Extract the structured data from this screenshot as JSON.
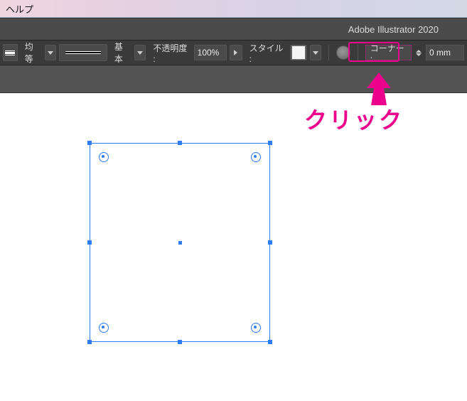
{
  "menubar": {
    "help": "ヘルプ"
  },
  "titlebar": {
    "app_title": "Adobe Illustrator 2020"
  },
  "controlbar": {
    "stroke_align_label": "均等",
    "stroke_profile_label": "基本",
    "opacity_label": "不透明度 :",
    "opacity_value": "100%",
    "style_label": "スタイル :",
    "corner_label": "コーナー :",
    "corner_value": "0 mm"
  },
  "annotation": {
    "click_text": "クリック"
  },
  "colors": {
    "accent": "#ec008c",
    "selection": "#2e7df6"
  }
}
